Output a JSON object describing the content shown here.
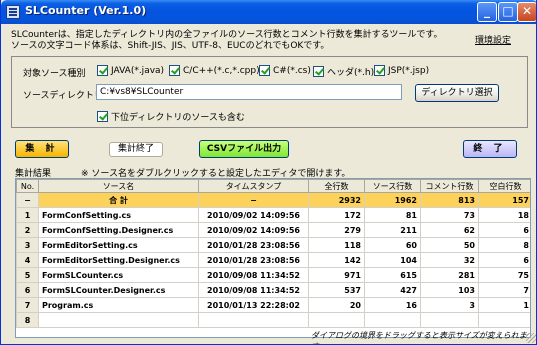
{
  "window": {
    "title": "SLCounter (Ver.1.0)",
    "min_glyph": "_",
    "max_glyph": "□",
    "close_glyph": "✕"
  },
  "description": {
    "line1": "SLCounterは、指定したディレクトリ内の全ファイルのソース行数とコメント行数を集計するツールです。",
    "line2": "ソースの文字コード体系は、Shift-JIS、JIS、UTF-8、EUCのどれでもOKです。"
  },
  "env_link": "環境設定",
  "source_types": {
    "label": "対象ソース種別",
    "items": [
      {
        "label": "JAVA(*.java)",
        "checked": true
      },
      {
        "label": "C/C++(*.c,*.cpp)",
        "checked": true
      },
      {
        "label": "C#(*.cs)",
        "checked": true
      },
      {
        "label": "ヘッダ(*.h)",
        "checked": true
      },
      {
        "label": "JSP(*.jsp)",
        "checked": true
      }
    ]
  },
  "directory": {
    "label": "ソースディレクトリ",
    "value": "C:¥vs8¥SLCounter",
    "select_button": "ディレクトリ選択",
    "include_sub": {
      "label": "下位ディレクトリのソースも含む",
      "checked": true
    }
  },
  "actions": {
    "count": "集 計",
    "stop": "集計終了",
    "csv": "CSVファイル出力",
    "end": "終 了"
  },
  "results": {
    "title": "集計結果",
    "note": "※ ソース名をダブルクリックすると設定したエディタで開けます。",
    "columns": [
      "No.",
      "ソース名",
      "タイムスタンプ",
      "全行数",
      "ソース行数",
      "コメント行数",
      "空白行数"
    ],
    "total": {
      "no": "−",
      "name": "合 計",
      "timestamp": "−",
      "all": "2932",
      "source": "1962",
      "comment": "813",
      "blank": "157"
    },
    "rows": [
      {
        "no": "1",
        "name": "FormConfSetting.cs",
        "timestamp": "2010/09/02 14:09:56",
        "all": "172",
        "source": "81",
        "comment": "73",
        "blank": "18"
      },
      {
        "no": "2",
        "name": "FormConfSetting.Designer.cs",
        "timestamp": "2010/09/02 14:09:56",
        "all": "279",
        "source": "211",
        "comment": "62",
        "blank": "6"
      },
      {
        "no": "3",
        "name": "FormEditorSetting.cs",
        "timestamp": "2010/01/28 23:08:56",
        "all": "118",
        "source": "60",
        "comment": "50",
        "blank": "8"
      },
      {
        "no": "4",
        "name": "FormEditorSetting.Designer.cs",
        "timestamp": "2010/01/28 23:08:56",
        "all": "142",
        "source": "104",
        "comment": "32",
        "blank": "6"
      },
      {
        "no": "5",
        "name": "FormSLCounter.cs",
        "timestamp": "2010/09/08 11:34:52",
        "all": "971",
        "source": "615",
        "comment": "281",
        "blank": "75"
      },
      {
        "no": "6",
        "name": "FormSLCounter.Designer.cs",
        "timestamp": "2010/09/08 11:34:52",
        "all": "537",
        "source": "427",
        "comment": "103",
        "blank": "7"
      },
      {
        "no": "7",
        "name": "Program.cs",
        "timestamp": "2010/01/13 22:28:02",
        "all": "20",
        "source": "16",
        "comment": "3",
        "blank": "1"
      },
      {
        "no": "8",
        "name": "",
        "timestamp": "",
        "all": "",
        "source": "",
        "comment": "",
        "blank": ""
      }
    ]
  },
  "footer_note": "ダイアログの境界をドラッグすると表示サイズが変えられます。"
}
